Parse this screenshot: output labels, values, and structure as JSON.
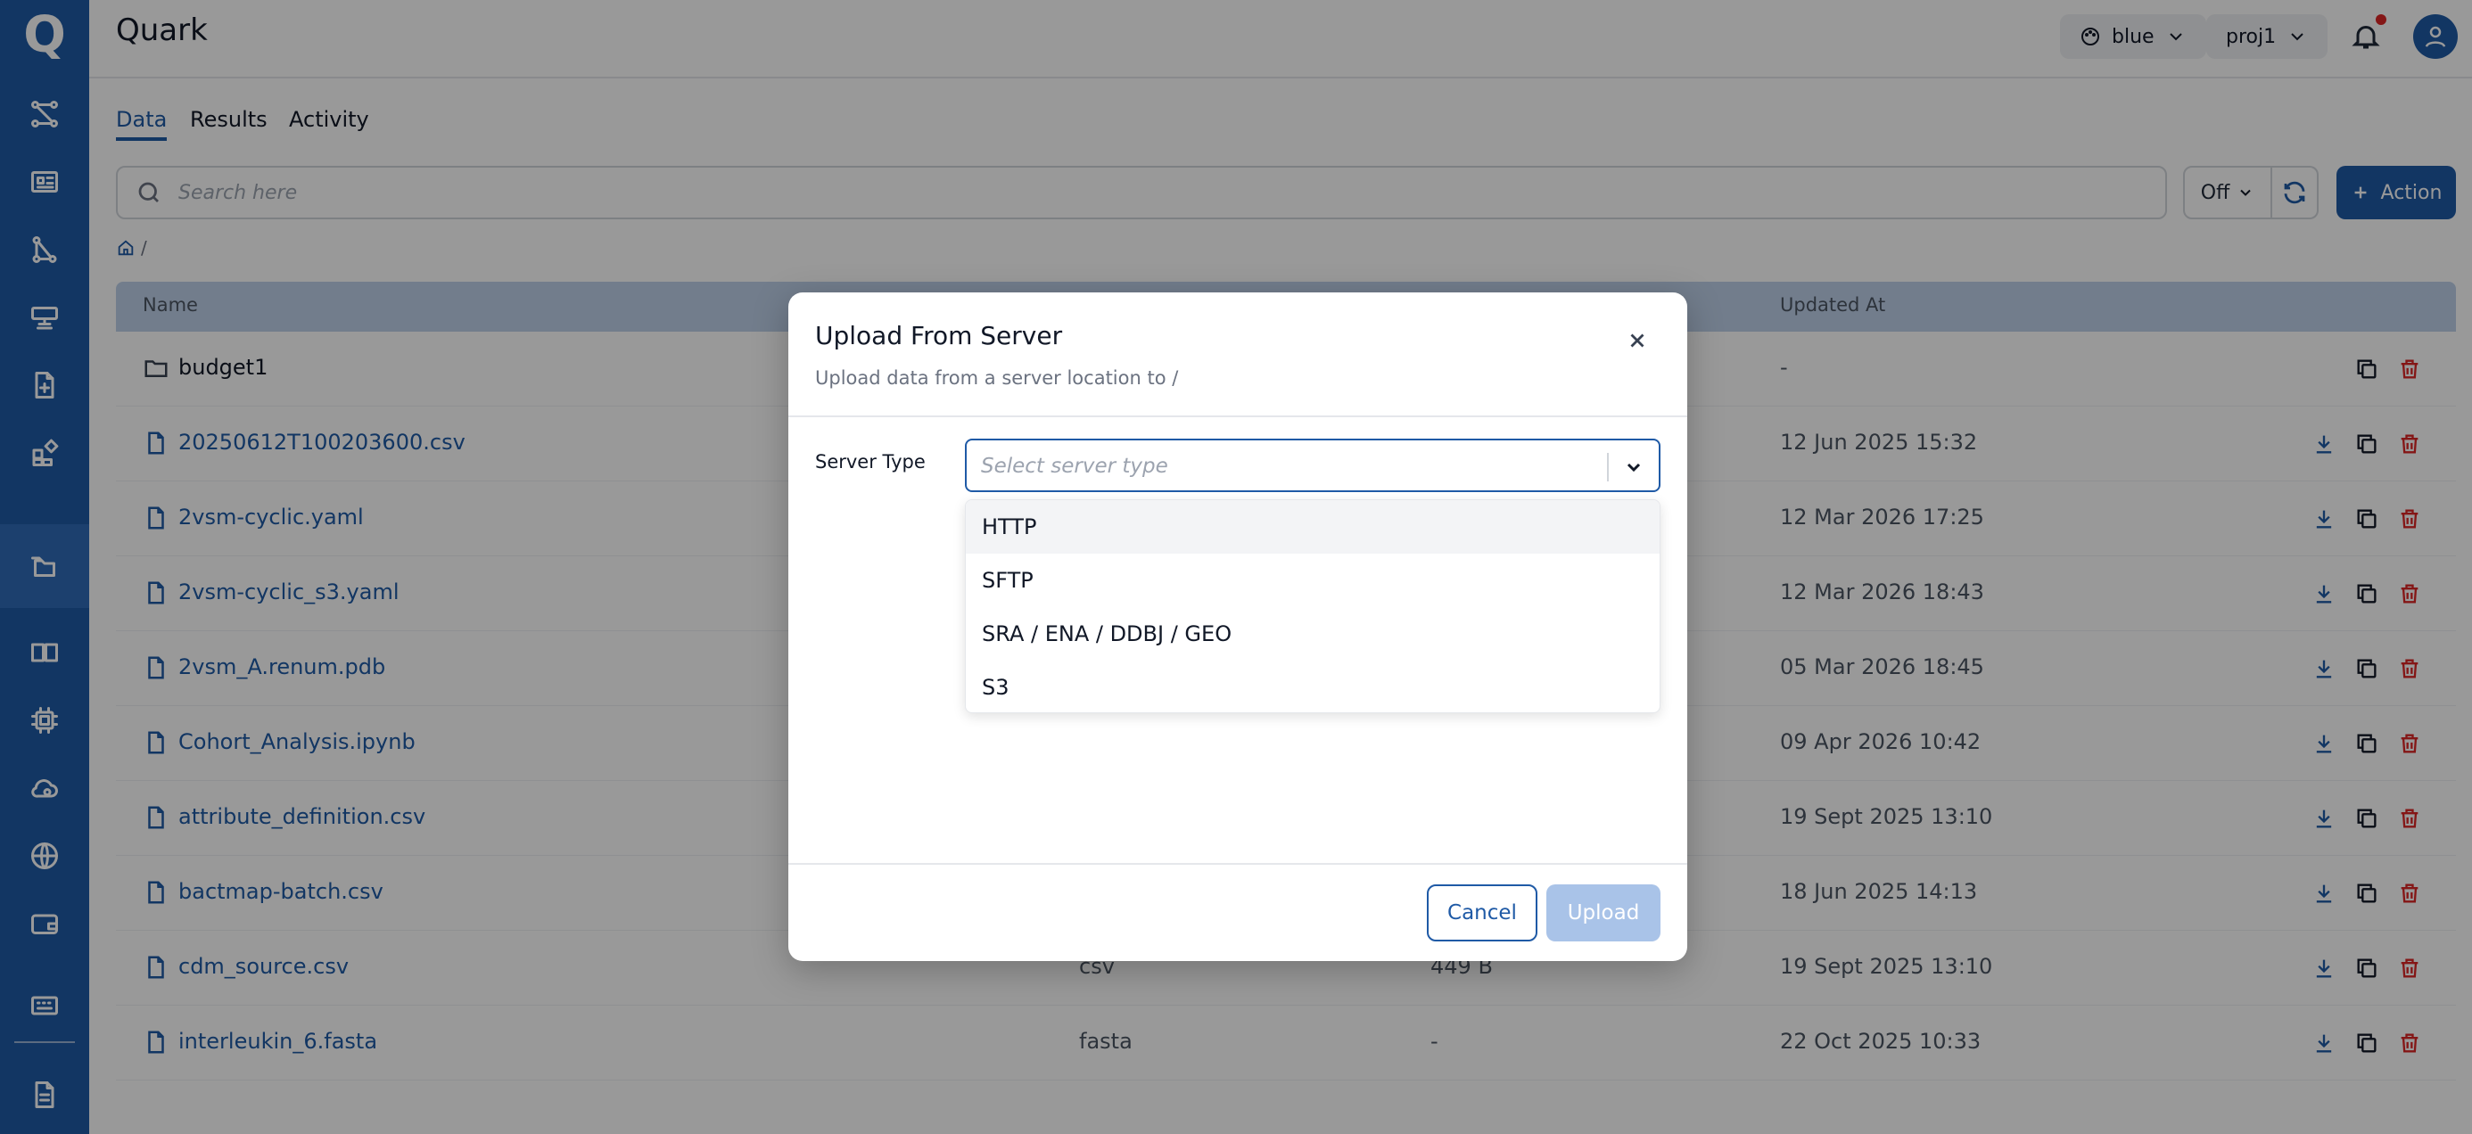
{
  "app": {
    "logo": "Q",
    "title": "Quark"
  },
  "header": {
    "theme_label": "blue",
    "project_label": "proj1"
  },
  "tabs": [
    {
      "label": "Data",
      "active": true
    },
    {
      "label": "Results",
      "active": false
    },
    {
      "label": "Activity",
      "active": false
    }
  ],
  "toolbar": {
    "search_placeholder": "Search here",
    "toggle_value": "Off",
    "action_label": "Action"
  },
  "breadcrumb": {
    "separator": "/"
  },
  "table": {
    "headers": {
      "name": "Name",
      "updated": "Updated At"
    },
    "rows": [
      {
        "name": "budget1",
        "kind": "folder",
        "type": "",
        "size": "",
        "updated": "-"
      },
      {
        "name": "20250612T100203600.csv",
        "kind": "file",
        "type": "",
        "size": "",
        "updated": "12 Jun 2025 15:32"
      },
      {
        "name": "2vsm-cyclic.yaml",
        "kind": "file",
        "type": "",
        "size": "",
        "updated": "12 Mar 2026 17:25"
      },
      {
        "name": "2vsm-cyclic_s3.yaml",
        "kind": "file",
        "type": "",
        "size": "",
        "updated": "12 Mar 2026 18:43"
      },
      {
        "name": "2vsm_A.renum.pdb",
        "kind": "file",
        "type": "",
        "size": "",
        "updated": "05 Mar 2026 18:45"
      },
      {
        "name": "Cohort_Analysis.ipynb",
        "kind": "file",
        "type": "",
        "size": "",
        "updated": "09 Apr 2026 10:42"
      },
      {
        "name": "attribute_definition.csv",
        "kind": "file",
        "type": "",
        "size": "",
        "updated": "19 Sept 2025 13:10"
      },
      {
        "name": "bactmap-batch.csv",
        "kind": "file",
        "type": "",
        "size": "",
        "updated": "18 Jun 2025 14:13"
      },
      {
        "name": "cdm_source.csv",
        "kind": "file",
        "type": "csv",
        "size": "449 B",
        "updated": "19 Sept 2025 13:10"
      },
      {
        "name": "interleukin_6.fasta",
        "kind": "file",
        "type": "fasta",
        "size": "-",
        "updated": "22 Oct 2025 10:33"
      }
    ]
  },
  "modal": {
    "title": "Upload From Server",
    "subtitle": "Upload data from a server location to /",
    "field_label": "Server Type",
    "select_placeholder": "Select server type",
    "options": [
      "HTTP",
      "SFTP",
      "SRA / ENA / DDBJ / GEO",
      "S3"
    ],
    "cancel_label": "Cancel",
    "upload_label": "Upload"
  },
  "colors": {
    "brand": "#1f5aa6",
    "danger": "#dc2626",
    "upload_disabled": "#a9c3e8"
  },
  "sidebar_icons": [
    "workflow-icon",
    "news-icon",
    "pipeline-icon",
    "server-icon",
    "file-plus-icon",
    "apps-icon",
    "folders-icon",
    "book-icon",
    "chip-icon",
    "cloud-icon",
    "globe-icon",
    "wallet-icon",
    "keyboard-icon",
    "document-icon"
  ]
}
